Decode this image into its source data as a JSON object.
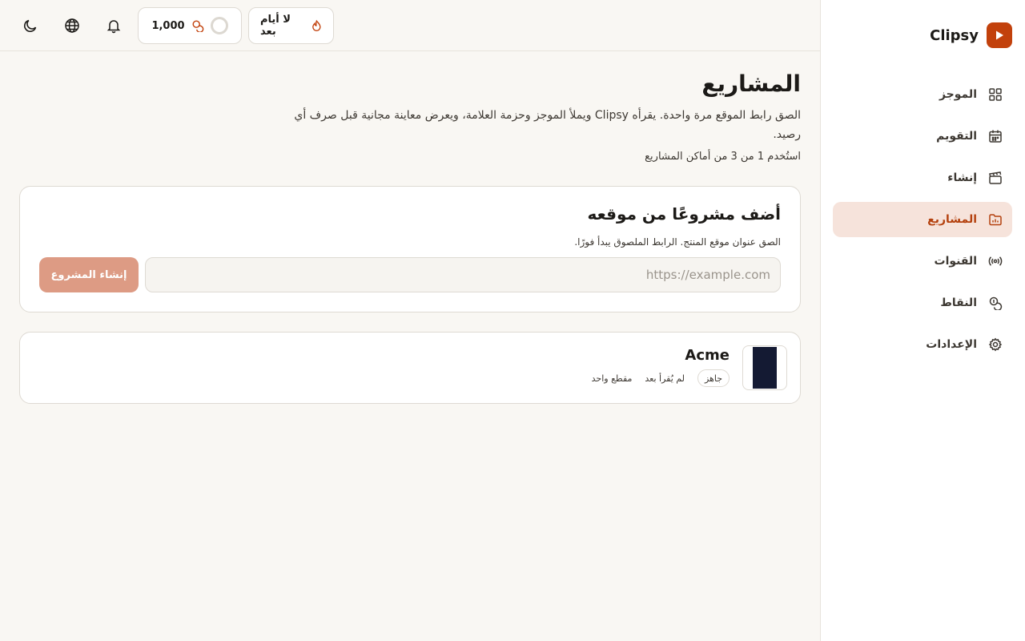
{
  "brand": {
    "name": "Clipsy",
    "accent": "#c2410c"
  },
  "sidebar": {
    "items": [
      {
        "label": "الموجز",
        "icon": "grid-icon",
        "active": false
      },
      {
        "label": "التقويم",
        "icon": "calendar-icon",
        "active": false
      },
      {
        "label": "إنشاء",
        "icon": "clapperboard-icon",
        "active": false
      },
      {
        "label": "المشاريع",
        "icon": "folder-icon",
        "active": true
      },
      {
        "label": "القنوات",
        "icon": "broadcast-icon",
        "active": false
      },
      {
        "label": "النقاط",
        "icon": "coins-icon",
        "active": false
      },
      {
        "label": "الإعدادات",
        "icon": "gear-icon",
        "active": false
      }
    ]
  },
  "topbar": {
    "streak_label": "لا أيام بعد",
    "credits": "1,000",
    "icons": [
      "bell-icon",
      "globe-icon",
      "moon-icon"
    ]
  },
  "main": {
    "title": "المشاريع",
    "description": "الصق رابط الموقع مرة واحدة. يقرأه Clipsy ويملأ الموجز وحزمة العلامة، ويعرض معاينة مجانية قبل صرف أي رصيد.",
    "usage": "استُخدم 1 من 3 من أماكن المشاريع"
  },
  "add_project": {
    "title": "أضف مشروعًا من موقعه",
    "subtitle": "الصق عنوان موقع المنتج. الرابط الملصوق يبدأ فورًا.",
    "input_placeholder": "https://example.com",
    "input_value": "",
    "button_label": "إنشاء المشروع"
  },
  "projects": [
    {
      "name": "Acme",
      "status": "جاهز",
      "read_status": "لم يُقرأ بعد",
      "clips": "مقطع واحد"
    }
  ]
}
